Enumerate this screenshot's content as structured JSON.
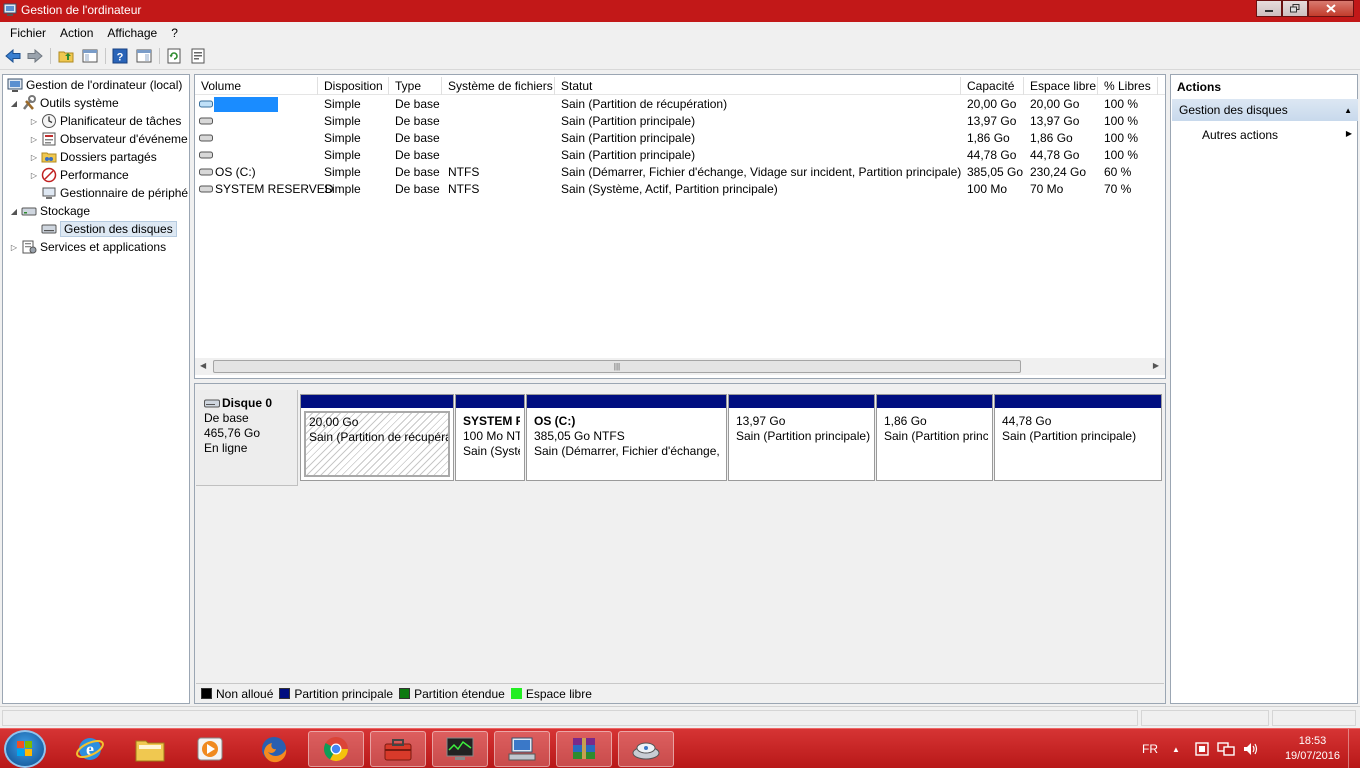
{
  "window": {
    "title": "Gestion de l'ordinateur"
  },
  "menu": [
    "Fichier",
    "Action",
    "Affichage",
    "?"
  ],
  "toolbar_icons": [
    "back-arrow-icon",
    "forward-arrow-icon",
    "up-folder-icon",
    "show-hide-tree-icon",
    "help-icon",
    "show-hide-action-pane-icon",
    "refresh-icon",
    "properties-icon"
  ],
  "tree": {
    "root": "Gestion de l'ordinateur (local)",
    "outils": "Outils système",
    "planificateur": "Planificateur de tâches",
    "observateur": "Observateur d'événeme",
    "dossiers": "Dossiers partagés",
    "performance": "Performance",
    "gestionnaire": "Gestionnaire de périphé",
    "stockage": "Stockage",
    "disques": "Gestion des disques",
    "services": "Services et applications"
  },
  "volumes": {
    "headers": [
      "Volume",
      "Disposition",
      "Type",
      "Système de fichiers",
      "Statut",
      "Capacité",
      "Espace libre",
      "% Libres"
    ],
    "rows": [
      {
        "volume": "",
        "disposition": "Simple",
        "type": "De base",
        "fs": "",
        "statut": "Sain (Partition de récupération)",
        "capacite": "20,00 Go",
        "libre": "20,00 Go",
        "pct": "100 %",
        "redacted": true
      },
      {
        "volume": "",
        "disposition": "Simple",
        "type": "De base",
        "fs": "",
        "statut": "Sain (Partition principale)",
        "capacite": "13,97 Go",
        "libre": "13,97 Go",
        "pct": "100 %"
      },
      {
        "volume": "",
        "disposition": "Simple",
        "type": "De base",
        "fs": "",
        "statut": "Sain (Partition principale)",
        "capacite": "1,86 Go",
        "libre": "1,86 Go",
        "pct": "100 %"
      },
      {
        "volume": "",
        "disposition": "Simple",
        "type": "De base",
        "fs": "",
        "statut": "Sain (Partition principale)",
        "capacite": "44,78 Go",
        "libre": "44,78 Go",
        "pct": "100 %"
      },
      {
        "volume": "OS (C:)",
        "disposition": "Simple",
        "type": "De base",
        "fs": "NTFS",
        "statut": "Sain (Démarrer, Fichier d'échange, Vidage sur incident, Partition principale)",
        "capacite": "385,05 Go",
        "libre": "230,24 Go",
        "pct": "60 %"
      },
      {
        "volume": "SYSTEM RESERVED",
        "disposition": "Simple",
        "type": "De base",
        "fs": "NTFS",
        "statut": "Sain (Système, Actif, Partition principale)",
        "capacite": "100 Mo",
        "libre": "70 Mo",
        "pct": "70 %"
      }
    ]
  },
  "disk": {
    "name": "Disque 0",
    "type": "De base",
    "size": "465,76 Go",
    "state": "En ligne",
    "partitions": [
      {
        "name": "",
        "size": "20,00 Go",
        "status": "Sain (Partition de récupéra",
        "selected": true
      },
      {
        "name": "SYSTEM R",
        "size": "100 Mo NT",
        "status": "Sain (Systè"
      },
      {
        "name": "OS  (C:)",
        "size": "385,05 Go NTFS",
        "status": "Sain (Démarrer, Fichier d'échange, V"
      },
      {
        "name": "",
        "size": "13,97 Go",
        "status": "Sain (Partition principale)"
      },
      {
        "name": "",
        "size": "1,86 Go",
        "status": "Sain (Partition princ"
      },
      {
        "name": "",
        "size": "44,78 Go",
        "status": "Sain (Partition principale)"
      }
    ]
  },
  "legend": [
    {
      "label": "Non alloué",
      "color": "#000000"
    },
    {
      "label": "Partition principale",
      "color": "#000e80"
    },
    {
      "label": "Partition étendue",
      "color": "#0c7a10"
    },
    {
      "label": "Espace libre",
      "color": "#22ee22"
    }
  ],
  "actions": {
    "title": "Actions",
    "section": "Gestion des disques",
    "item": "Autres actions"
  },
  "taskbar": {
    "apps": [
      "start-orb-icon",
      "internet-explorer-icon",
      "file-explorer-icon",
      "media-player-icon",
      "firefox-icon",
      "chrome-icon",
      "toolbox-app-icon",
      "monitor-app-icon",
      "computer-management-icon",
      "winrar-icon",
      "disk-utility-icon"
    ],
    "lang": "FR",
    "time": "18:53",
    "date": "19/07/2016"
  },
  "colors": {
    "titlebar": "#c21818",
    "taskbar": "#c82020",
    "partition_bar": "#000e80",
    "redaction": "#1a8cff"
  }
}
